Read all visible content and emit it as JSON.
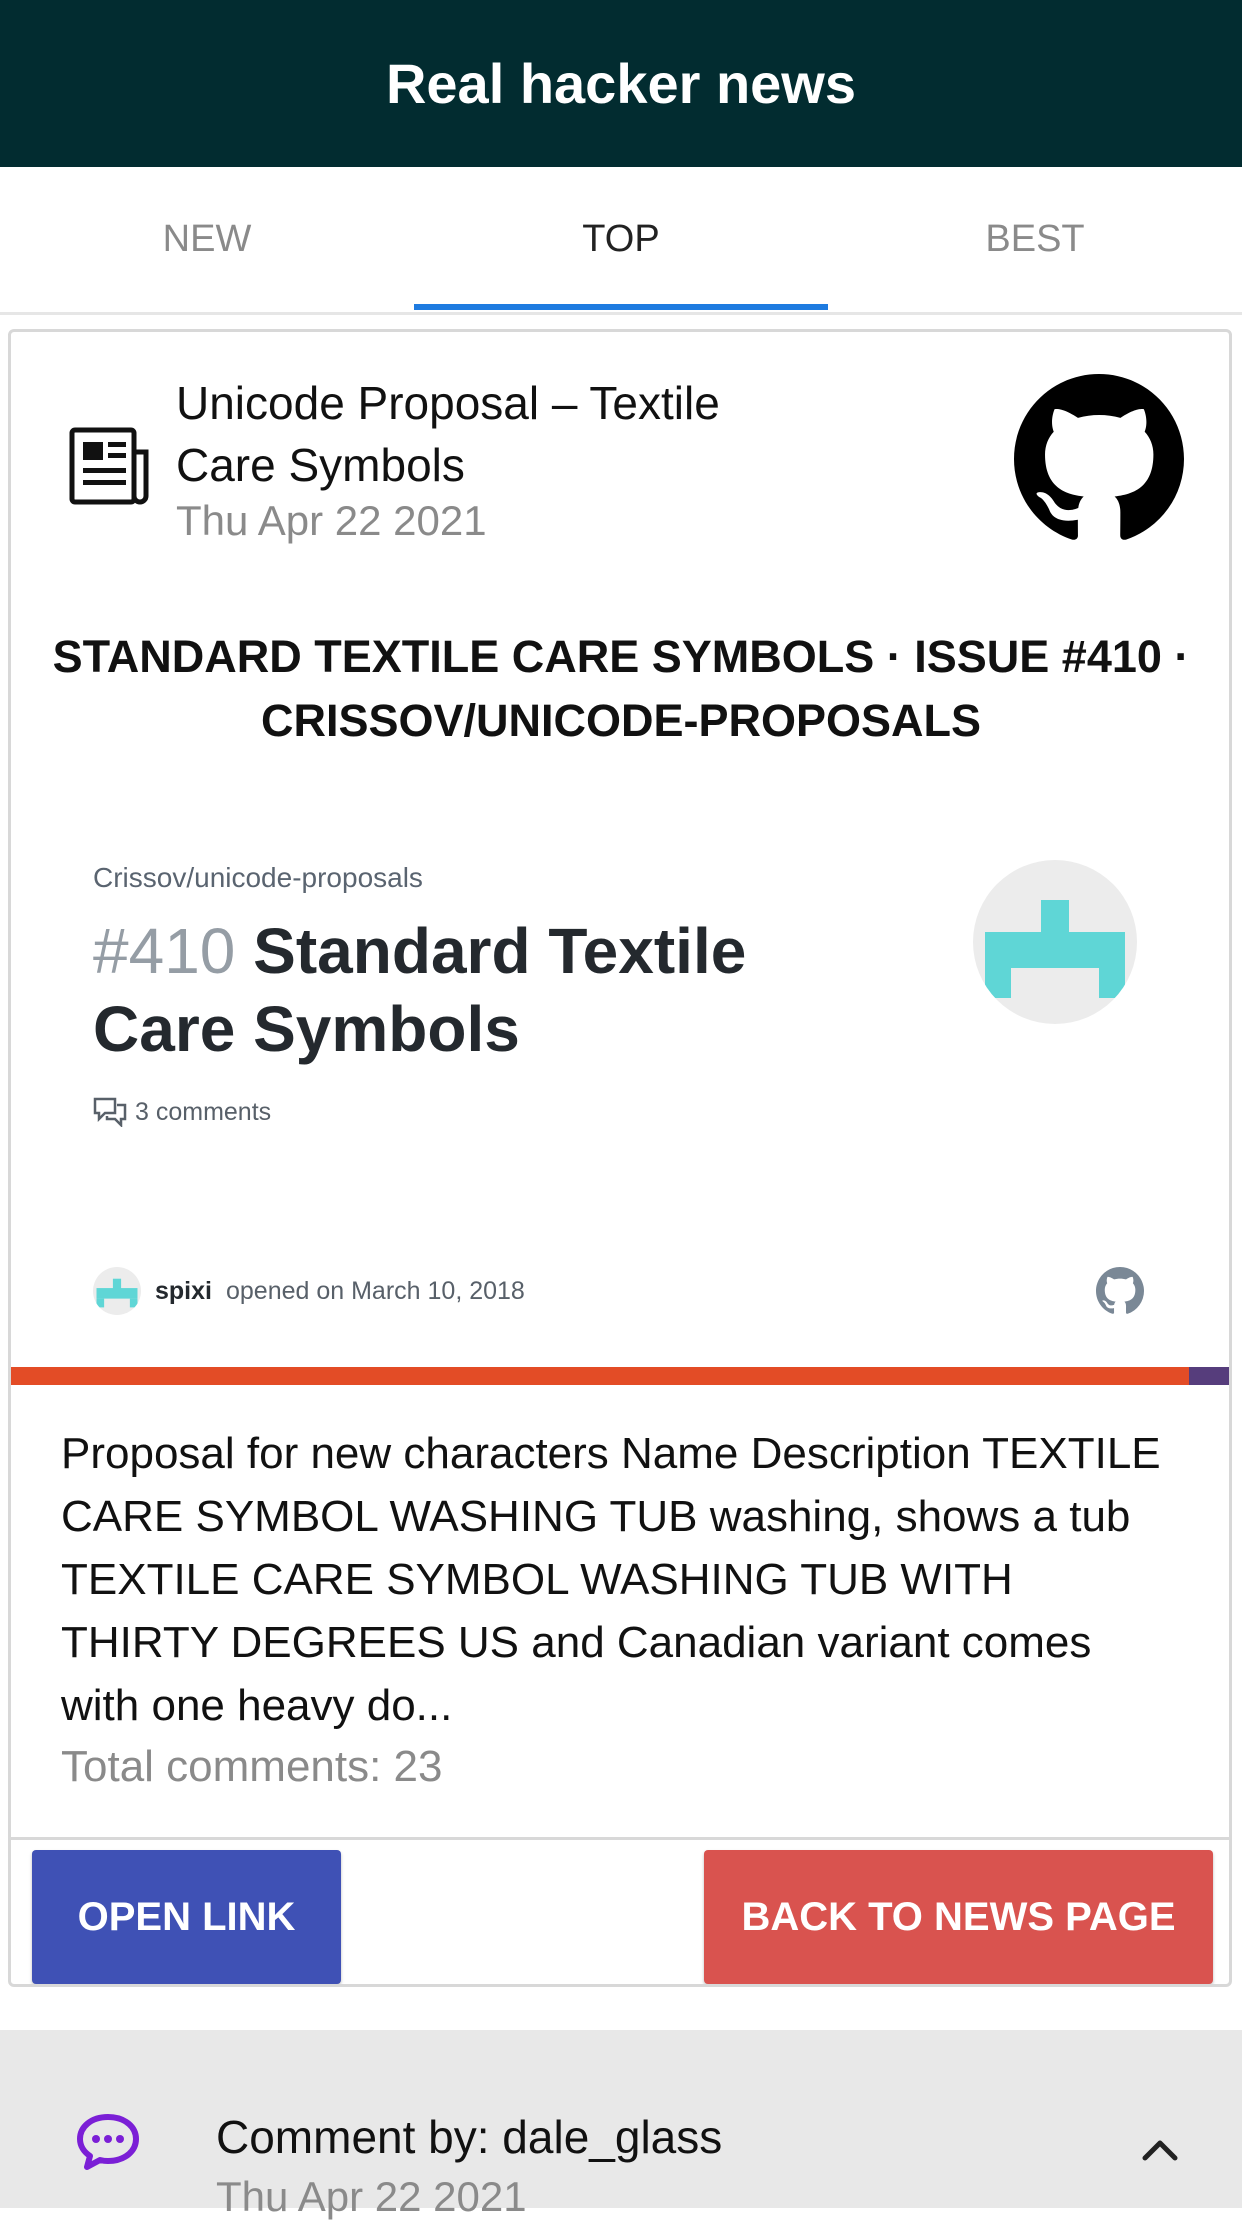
{
  "app": {
    "title": "Real hacker news"
  },
  "tabs": [
    {
      "label": "NEW"
    },
    {
      "label": "TOP",
      "active": true
    },
    {
      "label": "BEST"
    }
  ],
  "story": {
    "title": "Unicode Proposal – Textile Care Symbols",
    "date": "Thu Apr 22 2021",
    "heading": "STANDARD TEXTILE CARE SYMBOLS · ISSUE #410 · CRISSOV/UNICODE-PROPOSALS",
    "preview": {
      "repo": "Crissov/unicode-proposals",
      "issue_number": "#410",
      "issue_title": "Standard Textile Care Symbols",
      "comments": "3 comments",
      "opener": "spixi",
      "opened_text": "opened on March 10, 2018"
    },
    "text": " Proposal for new characters Name Description TEXTILE CARE SYMBOL WASHING TUB washing, shows a tub TEXTILE CARE SYMBOL WASHING TUB WITH THIRTY DEGREES US and Canadian variant comes with one heavy do...",
    "total_comments": "Total comments: 23"
  },
  "actions": {
    "open_link": "OPEN LINK",
    "back": "BACK TO NEWS PAGE"
  },
  "comment": {
    "by": "Comment by: dale_glass",
    "date": "Thu Apr 22 2021"
  },
  "icons": {
    "header_news": "newspaper-icon",
    "source": "github-icon",
    "comment": "comment-bubble-icon",
    "collapse": "chevron-up-icon"
  },
  "colors": {
    "appbar": "#022c30",
    "tab_indicator": "#1e7be0",
    "open_button": "#3f51b5",
    "back_button": "#d9534f",
    "comment_icon": "#7b1fd6"
  }
}
